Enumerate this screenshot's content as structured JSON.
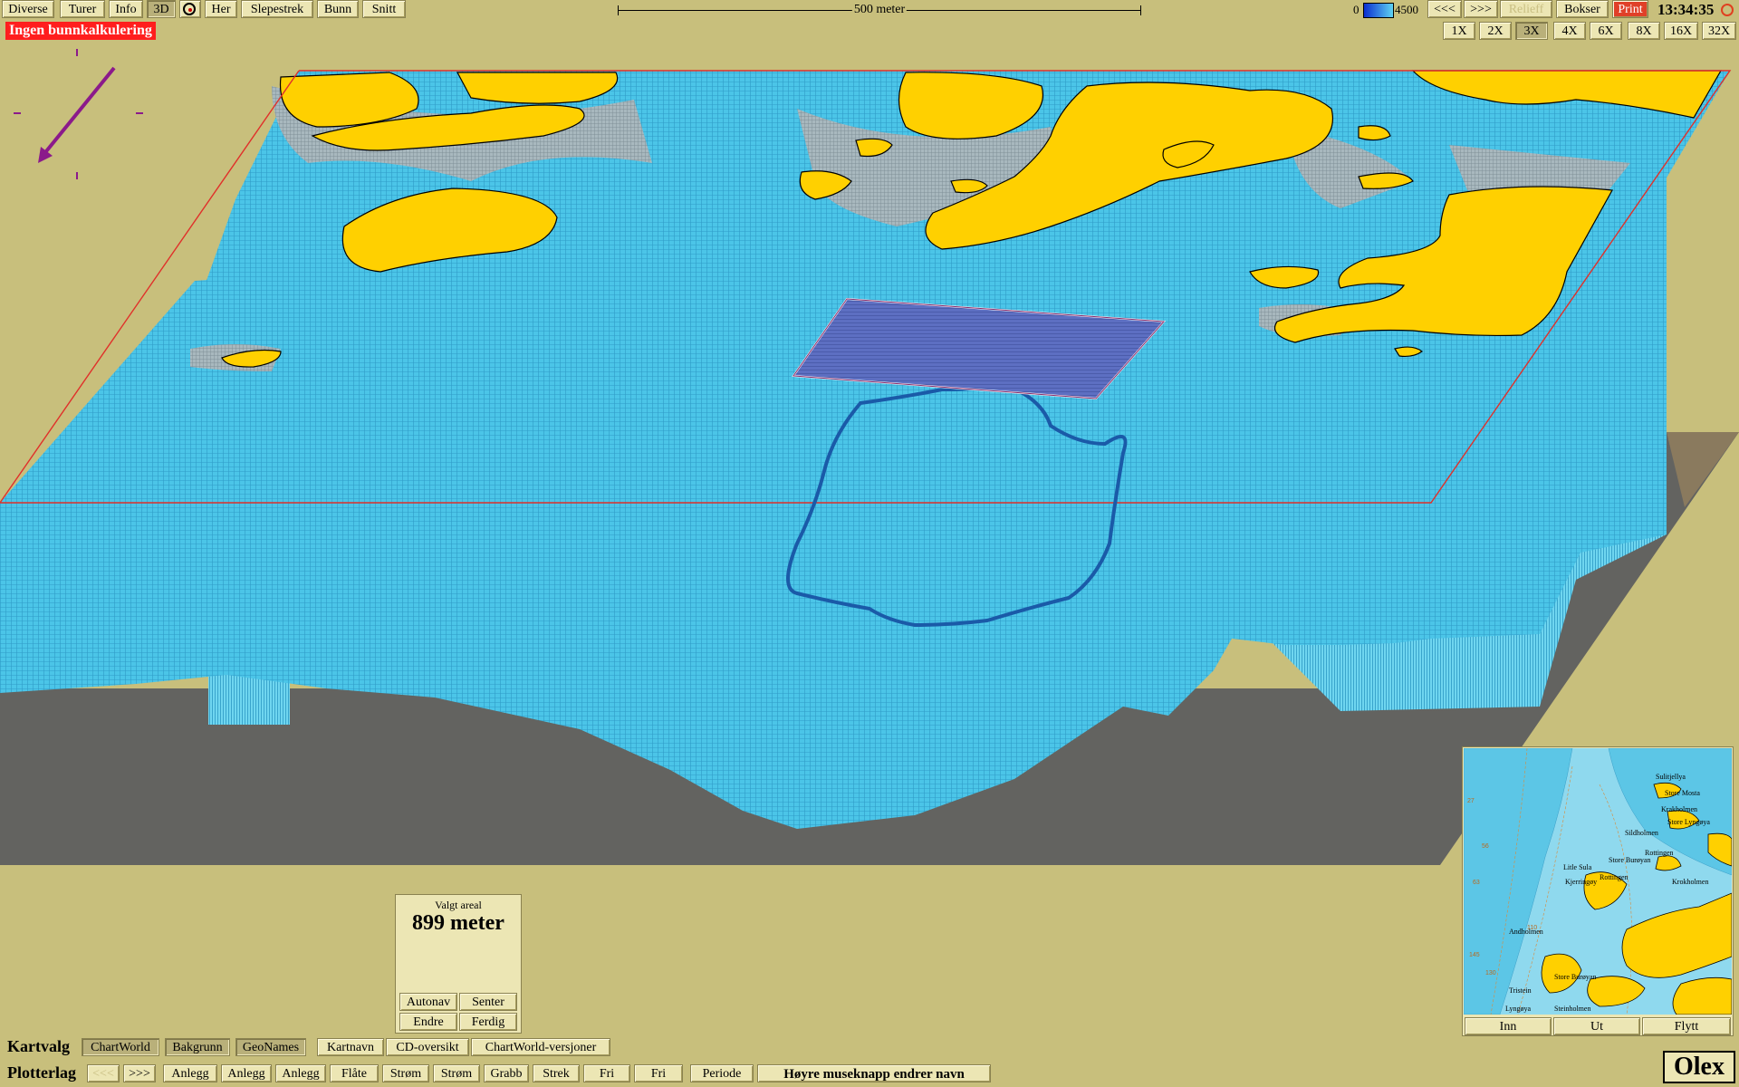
{
  "toolbar": {
    "menu": [
      "Diverse",
      "Turer",
      "Info",
      "3D",
      "Her",
      "Slepestrek",
      "Bunn",
      "Snitt"
    ],
    "scale_label": "500 meter",
    "depth_min": "0",
    "depth_max": "4500",
    "nav_prev": "<<<",
    "nav_next": ">>>",
    "relief": "Relieff",
    "boxes": "Bokser",
    "print": "Print",
    "clock": "13:34:35"
  },
  "zoom": {
    "levels": [
      "1X",
      "2X",
      "3X",
      "4X",
      "6X",
      "8X",
      "16X",
      "32X"
    ],
    "selected": "3X"
  },
  "status": {
    "no_calc": "Ingen bunnkalkulering"
  },
  "area_panel": {
    "label": "Valgt areal",
    "value": "899 meter",
    "buttons": [
      "Autonav",
      "Senter",
      "Endre",
      "Ferdig"
    ]
  },
  "kartvalg": {
    "label": "Kartvalg",
    "items": [
      "ChartWorld",
      "Bakgrunn",
      "GeoNames",
      "Kartnavn",
      "CD-oversikt",
      "ChartWorld-versjoner"
    ]
  },
  "plotterlag": {
    "label": "Plotterlag",
    "prev": "<<<",
    "next": ">>>",
    "items": [
      "Anlegg",
      "Anlegg",
      "Anlegg",
      "Flåte",
      "Strøm",
      "Strøm",
      "Grabb",
      "Strek",
      "Fri",
      "Fri",
      "Periode"
    ],
    "hint": "Høyre museknapp endrer navn"
  },
  "minimap": {
    "buttons": [
      "Inn",
      "Ut",
      "Flytt"
    ],
    "places": [
      "Sulitjellya",
      "Store Mosta",
      "Krakholmen",
      "Store Lyngøya",
      "Sildholmen",
      "Store Burøyan",
      "Rottingen",
      "Krokholmen",
      "Litle Sula",
      "Rottingen",
      "Kjerringøy",
      "Andholmen",
      "Store Burøyan",
      "Steinholmen",
      "Lyngøya",
      "Tristein"
    ],
    "depths": [
      "27",
      "56",
      "63",
      "145",
      "130",
      "110"
    ]
  },
  "brand": "Olex",
  "colors": {
    "background": "#c8bf7c",
    "sea": "#45c3e6",
    "land": "#ffd000",
    "shallow": "#9eb0b8",
    "ground": "#636360",
    "selection": "#5a6bbf",
    "warning": "#ff1e1e"
  }
}
